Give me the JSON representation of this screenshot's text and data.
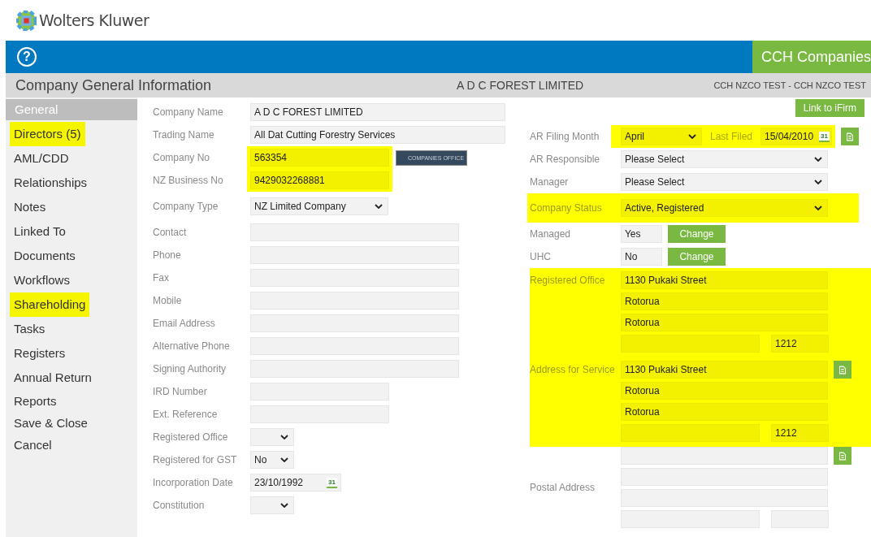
{
  "brand": {
    "name": "Wolters Kluwer"
  },
  "toolbar": {
    "help": "?",
    "product": "CCH Companies"
  },
  "title_bar": {
    "title": "Company General Information",
    "company": "A D C FOREST LIMITED",
    "user": "CCH NZCO TEST - CCH NZCO TEST"
  },
  "sidebar": {
    "items": [
      {
        "label": "General",
        "selected": true,
        "highlighted": false
      },
      {
        "label": "Directors (5)",
        "selected": false,
        "highlighted": true
      },
      {
        "label": "AML/CDD",
        "selected": false,
        "highlighted": false
      },
      {
        "label": "Relationships",
        "selected": false,
        "highlighted": false
      },
      {
        "label": "Notes",
        "selected": false,
        "highlighted": false
      },
      {
        "label": "Linked To",
        "selected": false,
        "highlighted": false
      },
      {
        "label": "Documents",
        "selected": false,
        "highlighted": false
      },
      {
        "label": "Workflows",
        "selected": false,
        "highlighted": false
      },
      {
        "label": "Shareholding",
        "selected": false,
        "highlighted": true
      },
      {
        "label": "Tasks",
        "selected": false,
        "highlighted": false
      },
      {
        "label": "Registers",
        "selected": false,
        "highlighted": false
      },
      {
        "label": "Annual Return",
        "selected": false,
        "highlighted": false
      },
      {
        "label": "Reports",
        "selected": false,
        "highlighted": false
      },
      {
        "label": "Save & Close",
        "selected": false,
        "highlighted": false
      },
      {
        "label": "Cancel",
        "selected": false,
        "highlighted": false
      }
    ]
  },
  "left_fields": [
    {
      "label": "Company Name",
      "kind": "wide-text",
      "value": "A D C FOREST LIMITED",
      "highlighted": false
    },
    {
      "label": "Trading Name",
      "kind": "wide-text",
      "value": "All Dat Cutting Forestry Services",
      "highlighted": false
    },
    {
      "label": "Company No",
      "kind": "medium-text",
      "value": "563354",
      "highlighted": true,
      "badge": "COMPANIES OFFICE"
    },
    {
      "label": "NZ Business No",
      "kind": "medium-text",
      "value": "9429032268881",
      "highlighted": true
    },
    {
      "label": "Company Type",
      "kind": "select",
      "value": "NZ Limited Company",
      "highlighted": false
    },
    {
      "label": "Contact",
      "kind": "text",
      "highlighted": false
    },
    {
      "label": "Phone",
      "kind": "text",
      "highlighted": false
    },
    {
      "label": "Fax",
      "kind": "text",
      "highlighted": false
    },
    {
      "label": "Mobile",
      "kind": "text",
      "highlighted": false
    },
    {
      "label": "Email Address",
      "kind": "text",
      "highlighted": false
    },
    {
      "label": "Alternative Phone",
      "kind": "text",
      "highlighted": false
    },
    {
      "label": "Signing Authority",
      "kind": "text",
      "highlighted": false
    },
    {
      "label": "IRD Number",
      "kind": "medium-text",
      "highlighted": false
    },
    {
      "label": "Ext. Reference",
      "kind": "medium-text",
      "highlighted": false
    },
    {
      "label": "Registered Office",
      "kind": "small-select",
      "highlighted": false
    },
    {
      "label": "Registered for GST",
      "kind": "small-select",
      "value": "No",
      "highlighted": false
    },
    {
      "label": "Incorporation Date",
      "kind": "date",
      "value": "23/10/1992",
      "calendar": "31",
      "highlighted": false
    },
    {
      "label": "Constitution",
      "kind": "small-select",
      "highlighted": false
    }
  ],
  "link_button": "Link to iFirm",
  "right_fields": [
    {
      "label": "AR Filing Month",
      "kind": "month-date",
      "value": "April",
      "date_label": "Last Filed",
      "date": "15/04/2010",
      "calendar": "31",
      "highlighted": true
    },
    {
      "label": "AR Responsible",
      "kind": "select",
      "value": "Please Select",
      "highlighted": false
    },
    {
      "label": "Manager",
      "kind": "select",
      "value": "Please Select",
      "highlighted": false
    },
    {
      "label": "Company Status",
      "kind": "select",
      "value": "Active, Registered",
      "highlighted": true
    },
    {
      "label": "Managed",
      "kind": "toggle",
      "value": "Yes",
      "button": "Change",
      "highlighted": false
    },
    {
      "label": "UHC",
      "kind": "toggle",
      "value": "No",
      "button": "Change",
      "highlighted": false
    },
    {
      "label": "Registered Office",
      "kind": "address",
      "lines": [
        "1130 Pukaki Street",
        "Rotorua",
        "Rotorua"
      ],
      "postcode": "1212",
      "copy": false,
      "highlighted": true
    },
    {
      "label": "Address for Service",
      "kind": "address",
      "lines": [
        "1130 Pukaki Street",
        "Rotorua",
        "Rotorua"
      ],
      "postcode": "1212",
      "copy": true,
      "highlighted": true
    },
    {
      "label": "Postal Address",
      "kind": "empty-address",
      "copy": true,
      "highlighted": false
    }
  ]
}
